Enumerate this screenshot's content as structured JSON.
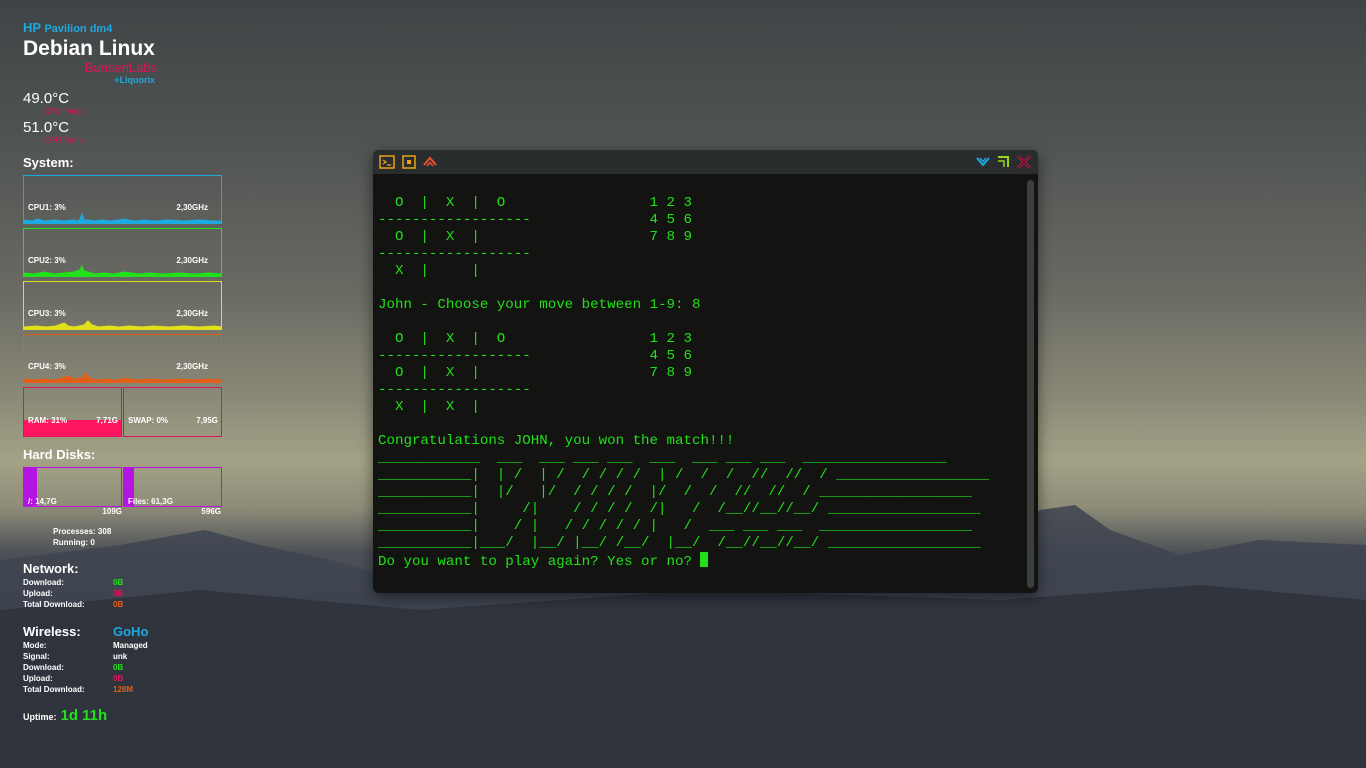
{
  "colors": {
    "cyan": "#1ea8e0",
    "green": "#22e01a",
    "yellow": "#e0e01a",
    "orange": "#e0601a",
    "pink": "#e0135a",
    "purple": "#b515e0"
  },
  "conky": {
    "brand": "HP",
    "model": "Pavilion dm4",
    "distro": "Debian Linux",
    "flavor": "BunsenLabs",
    "kernel": "+Liquorix",
    "cpu_temp": "49.0°C",
    "cpu_temp_label": "CPU Temp",
    "gpu_temp": "51.0°C",
    "gpu_temp_label": "GPU Temp",
    "system_label": "System:",
    "cpus": [
      {
        "label": "CPU1: 3%",
        "freq": "2,30GHz"
      },
      {
        "label": "CPU2: 3%",
        "freq": "2,30GHz"
      },
      {
        "label": "CPU3: 3%",
        "freq": "2,30GHz"
      },
      {
        "label": "CPU4: 3%",
        "freq": "2,30GHz"
      }
    ],
    "ram": {
      "label": "RAM: 31%",
      "total": "7,71G",
      "fraction": 0.31
    },
    "swap": {
      "label": "SWAP: 0%",
      "total": "7,95G"
    },
    "disks_label": "Hard Disks:",
    "disks": [
      {
        "label": "/: 14,7G",
        "total": "109G",
        "fraction": 0.13
      },
      {
        "label": "Files: 61,3G",
        "total": "596G",
        "fraction": 0.1
      }
    ],
    "processes": "Processes: 308",
    "running": "Running: 0",
    "network": {
      "title": "Network:",
      "rows": [
        {
          "k": "Download:",
          "v": "0B",
          "c": "green"
        },
        {
          "k": "Upload:",
          "v": "0B",
          "c": "pink"
        },
        {
          "k": "Total Download:",
          "v": "0B",
          "c": "orange"
        }
      ]
    },
    "wireless": {
      "title": "Wireless:",
      "ssid": "GoHo",
      "rows": [
        {
          "k": "Mode:",
          "v": "Managed",
          "c": "white"
        },
        {
          "k": "Signal:",
          "v": "unk",
          "c": "white"
        },
        {
          "k": "Download:",
          "v": "0B",
          "c": "green"
        },
        {
          "k": "Upload:",
          "v": "0B",
          "c": "pink"
        },
        {
          "k": "Total Download:",
          "v": "128M",
          "c": "orange"
        }
      ]
    },
    "uptime_label": "Uptime:",
    "uptime": "1d 11h"
  },
  "terminal": {
    "lines": [
      "  O  |  X  |  O                 1 2 3",
      "------------------              4 5 6",
      "  O  |  X  |                    7 8 9",
      "------------------",
      "  X  |     |",
      "",
      "John - Choose your move between 1-9: 8",
      "",
      "  O  |  X  |  O                 1 2 3",
      "------------------              4 5 6",
      "  O  |  X  |                    7 8 9",
      "------------------",
      "  X  |  X  |",
      "",
      "Congratulations JOHN, you won the match!!!",
      "____________  ___  ___ ___ ___  ___  ___ ___ ___  _________________",
      "___________|  | /  | /  / / / /  | /  /  /  //  //  / __________________",
      "___________|  |/   |/  / / / /  |/  /  /  //  //  / __________________",
      "___________|     /|    / / / /  /|   /  /__//__//__/ __________________",
      "___________|    / |   / / / / / |   /  ___ ___ ___  __________________",
      "___________|___/  |__/ |__/ /__/  |__/  /__//__//__/ __________________"
    ],
    "prompt": "Do you want to play again? Yes or no? "
  }
}
